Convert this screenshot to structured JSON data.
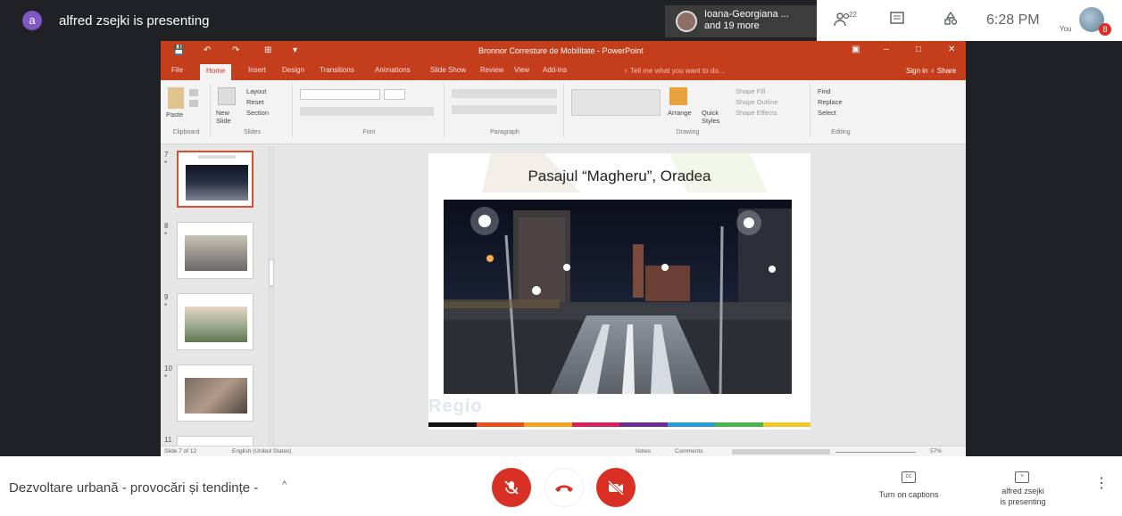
{
  "top_bar": {
    "presenter_initial": "a",
    "presenter_text": "alfred zsejki is presenting",
    "participants_line1": "Ioana-Georgiana ...",
    "participants_line2": "and 19 more",
    "people_icon_badge": "22",
    "time": "6:28 PM",
    "self_label": "You",
    "self_badge": "8"
  },
  "powerpoint": {
    "window_title": "Bronnor Corresture de Mobilitate - PowerPoint",
    "window_buttons": [
      "▣",
      "–",
      "□",
      "✕"
    ],
    "quick_access": [
      "💾",
      "↶",
      "↷",
      "⊞",
      "▾"
    ],
    "tabs": [
      "File",
      "Home",
      "Insert",
      "Design",
      "Transitions",
      "Animations",
      "Slide Show",
      "Review",
      "View",
      "Add-ins"
    ],
    "active_tab": "Home",
    "tell_me": "♀ Tell me what you want to do...",
    "sign_in": "Sign in  ♀ Share",
    "ribbon": {
      "paste": "Paste",
      "new_slide": "New Slide",
      "layout": "Layout",
      "reset": "Reset",
      "section": "Section",
      "arrange": "Arrange",
      "quick_styles": "Quick Styles",
      "shape_fill": "Shape Fill",
      "shape_outline": "Shape Outline",
      "shape_effects": "Shape Effects",
      "find": "Find",
      "replace": "Replace",
      "select": "Select",
      "groups": [
        "Clipboard",
        "Slides",
        "Font",
        "Paragraph",
        "Drawing",
        "Editing"
      ]
    },
    "thumbnails": [
      {
        "number": "7",
        "star": "*"
      },
      {
        "number": "8",
        "star": "*"
      },
      {
        "number": "9",
        "star": "*"
      },
      {
        "number": "10",
        "star": "*"
      },
      {
        "number": "11",
        "star": ""
      }
    ],
    "slide": {
      "title": "Pasajul “Magheru”, Oradea",
      "watermark": "Regio",
      "stripe_colors": [
        "#111111",
        "#e84f1c",
        "#f6a21e",
        "#d91f5a",
        "#6a2c91",
        "#2a9ad6",
        "#45b649",
        "#f2c72a"
      ]
    },
    "status": {
      "slide_of": "Slide 7 of 12",
      "language": "English (United States)",
      "notes": "Notes",
      "comments": "Comments",
      "zoom": "57%"
    }
  },
  "bottom_bar": {
    "meeting_title": "Dezvoltare urbană - provocări și tendințe -",
    "chevron": "^",
    "mic_icon": "🎤",
    "hangup_icon": "☎",
    "camera_icon": "📷",
    "captions_label": "Turn on captions",
    "present_label_1": "alfred zsejki",
    "present_label_2": "is presenting",
    "more_icon": "⋮"
  },
  "colors": {
    "meet_dark": "#202124",
    "ppt_accent": "#c43e1c",
    "meet_red": "#d93025"
  }
}
